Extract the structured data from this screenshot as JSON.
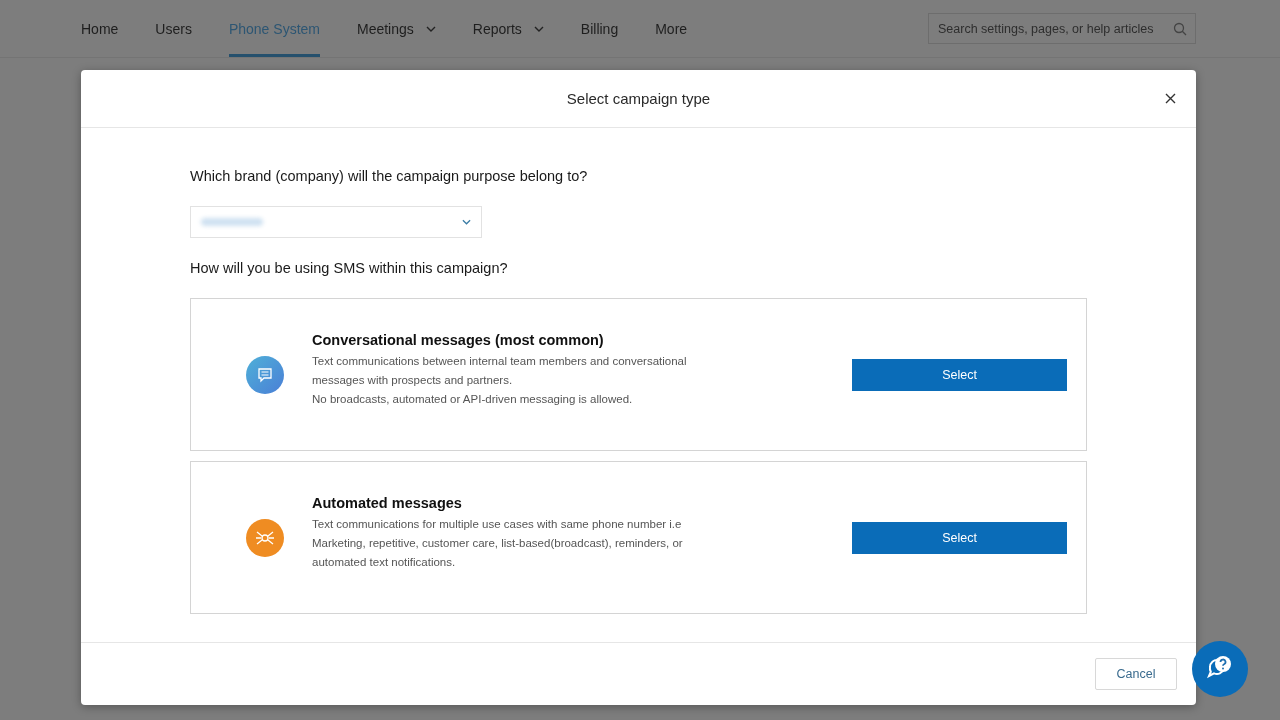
{
  "nav": {
    "items": [
      {
        "label": "Home",
        "selected": false,
        "dropdown": false
      },
      {
        "label": "Users",
        "selected": false,
        "dropdown": false
      },
      {
        "label": "Phone System",
        "selected": true,
        "dropdown": false
      },
      {
        "label": "Meetings",
        "selected": false,
        "dropdown": true
      },
      {
        "label": "Reports",
        "selected": false,
        "dropdown": true
      },
      {
        "label": "Billing",
        "selected": false,
        "dropdown": false
      },
      {
        "label": "More",
        "selected": false,
        "dropdown": false
      }
    ],
    "search": {
      "placeholder": "Search settings, pages, or help articles"
    }
  },
  "dialog": {
    "title": "Select campaign type",
    "brand_question": "Which brand (company) will the campaign purpose belong to?",
    "usage_question": "How will you be using SMS within this campaign?",
    "options": [
      {
        "kind": "conversational",
        "title": "Conversational messages (most common)",
        "lines": [
          "Text communications between internal team members and conversational",
          "messages with prospects and partners.",
          "No broadcasts, automated or API-driven messaging is allowed."
        ],
        "button": "Select"
      },
      {
        "kind": "automated",
        "title": "Automated messages",
        "lines": [
          "Text communications for multiple use cases with same phone number i.e",
          "Marketing, repetitive, customer care, list-based(broadcast), reminders, or",
          "automated text notifications."
        ],
        "button": "Select"
      }
    ],
    "cancel": "Cancel"
  }
}
